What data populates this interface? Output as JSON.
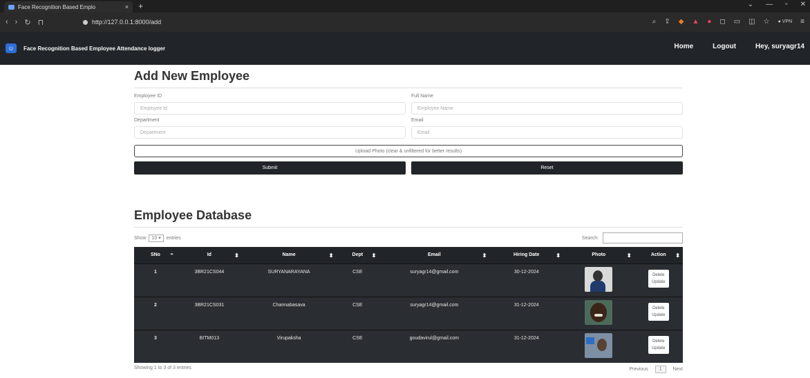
{
  "browser": {
    "tab_title": "Face Recognition Based Emplo",
    "tab_close": "×",
    "new_tab": "+",
    "url": "http://127.0.0.1:8000/add"
  },
  "navbar": {
    "brand": "Face Recognition Based Employee Attendance logger",
    "links": [
      "Home",
      "Logout",
      "Hey, suryagr14"
    ]
  },
  "form": {
    "title": "Add New Employee",
    "employee_id_label": "Employee ID",
    "employee_id_placeholder": "Employee Id",
    "full_name_label": "Full Name",
    "full_name_placeholder": "Employee Name",
    "department_label": "Department",
    "department_placeholder": "Department",
    "email_label": "Email",
    "email_placeholder": "Email",
    "upload_label": "Upload Photo (clear & unfiltered for better results)",
    "submit_label": "Submit",
    "reset_label": "Reset"
  },
  "database": {
    "title": "Employee Database",
    "show_prefix": "Show",
    "entries_value": "10",
    "show_suffix": "entries",
    "search_label": "Search:",
    "columns": [
      "SNo",
      "Id",
      "Name",
      "Dept",
      "Email",
      "Hiring Date",
      "Photo",
      "Action"
    ],
    "rows": [
      {
        "sno": "1",
        "id": "3BR21CS044",
        "name": "SURYANARAYANA",
        "dept": "CSE",
        "email": "suryagr14@gmail.com",
        "date": "30-12-2024"
      },
      {
        "sno": "2",
        "id": "3BR21CS031",
        "name": "Channabasava",
        "dept": "CSE",
        "email": "suryagr14@gmail.com",
        "date": "31-12-2024"
      },
      {
        "sno": "3",
        "id": "BITM013",
        "name": "Virupaksha",
        "dept": "CSE",
        "email": "goudavirul@gmail.com",
        "date": "31-12-2024"
      }
    ],
    "delete_label": "Delete",
    "update_label": "Update",
    "footer_info": "Showing 1 to 3 of 3 entries",
    "prev_label": "Previous",
    "page": "1",
    "next_label": "Next"
  }
}
